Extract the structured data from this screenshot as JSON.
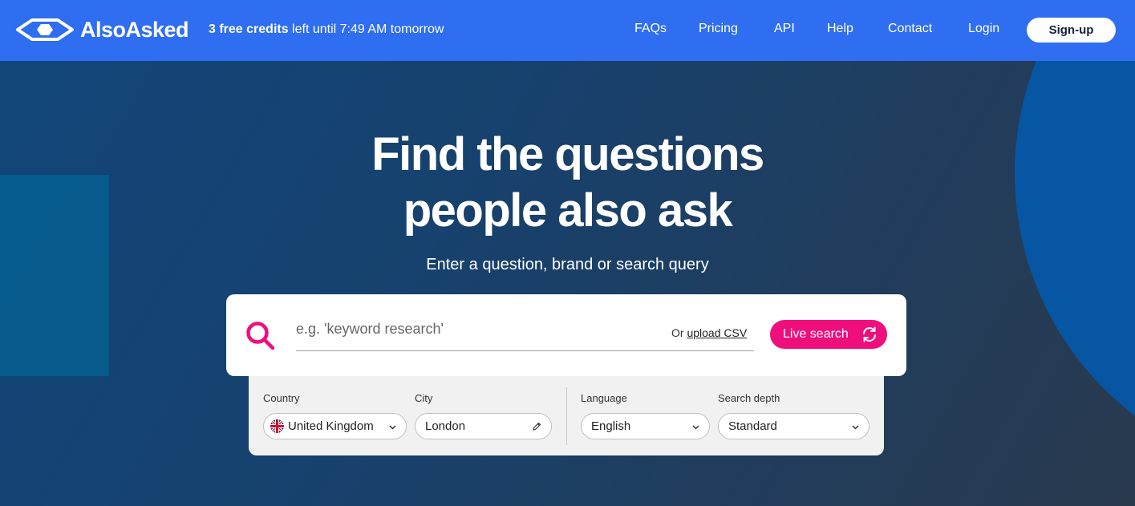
{
  "header": {
    "logo_text": "AlsoAsked",
    "credits_bold": "3 free credits",
    "credits_rest": " left until 7:49 AM tomorrow",
    "nav": [
      "FAQs",
      "Pricing",
      "API",
      "Help",
      "Contact",
      "Login"
    ],
    "signup_label": "Sign-up"
  },
  "hero": {
    "title_line1": "Find the questions",
    "title_line2": "people also ask",
    "subtitle": "Enter a question, brand or search query"
  },
  "search": {
    "placeholder": "e.g. 'keyword research'",
    "value": "",
    "or_text": "Or ",
    "upload_label": "upload CSV",
    "live_search_label": "Live search"
  },
  "options": {
    "country_label": "Country",
    "country_value": "United Kingdom",
    "city_label": "City",
    "city_value": "London",
    "language_label": "Language",
    "language_value": "English",
    "depth_label": "Search depth",
    "depth_value": "Standard"
  },
  "colors": {
    "nav_bg": "#2f6ef1",
    "accent_pink": "#ef0f7c",
    "hero_bg": "#17416d"
  }
}
